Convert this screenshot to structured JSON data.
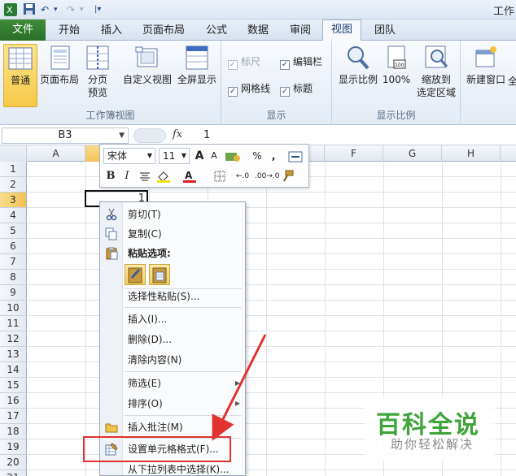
{
  "window": {
    "title": "工作"
  },
  "quick_access": {
    "undo": "↶",
    "redo": "↷",
    "more": "▾",
    "save": "💾"
  },
  "tabs": [
    {
      "label": "文件"
    },
    {
      "label": "开始"
    },
    {
      "label": "插入"
    },
    {
      "label": "页面布局"
    },
    {
      "label": "公式"
    },
    {
      "label": "数据"
    },
    {
      "label": "审阅"
    },
    {
      "label": "视图"
    },
    {
      "label": "团队"
    }
  ],
  "ribbon": {
    "workbook_views": {
      "label": "工作簿视图",
      "normal": "普通",
      "page_layout": "页面布局",
      "page_break_1": "分页",
      "page_break_2": "预览",
      "custom_view": "自定义视图",
      "full_screen": "全屏显示"
    },
    "show": {
      "label": "显示",
      "ruler": "标尺",
      "formula_bar": "编辑栏",
      "gridlines": "网格线",
      "headings": "标题"
    },
    "zoom": {
      "label": "显示比例",
      "zoom": "显示比例",
      "zoom100": "100%",
      "zoom_sel_1": "缩放到",
      "zoom_sel_2": "选定区域"
    },
    "window": {
      "new_window": "新建窗口",
      "more": "全"
    }
  },
  "formula_bar": {
    "name_box": "B3",
    "fx": "fx",
    "value": "1"
  },
  "columns": [
    "A",
    "B",
    "C",
    "D",
    "E",
    "F",
    "G",
    "H"
  ],
  "rows": [
    "1",
    "2",
    "3",
    "4",
    "5",
    "6",
    "7",
    "8",
    "9",
    "10",
    "11",
    "12",
    "13",
    "14",
    "15",
    "16",
    "17",
    "18",
    "19",
    "20",
    "21"
  ],
  "cell_b3": "1",
  "mini_toolbar": {
    "font": "宋体",
    "size": "11",
    "grow": "A",
    "shrink": "A",
    "percent": "%",
    "comma": ",",
    "bold": "B",
    "italic": "I",
    "inc_dec_1": "←.0",
    "inc_dec_2": ".00→.0"
  },
  "context_menu": {
    "cut": "剪切(T)",
    "copy": "复制(C)",
    "paste_options": "粘贴选项:",
    "paste_special": "选择性粘贴(S)...",
    "insert": "插入(I)...",
    "delete": "删除(D)...",
    "clear": "清除内容(N)",
    "filter": "筛选(E)",
    "sort": "排序(O)",
    "insert_comment": "插入批注(M)",
    "format_cells": "设置单元格格式(F)...",
    "pick_from_list": "从下拉列表中选择(K)..."
  },
  "watermark": {
    "title": "百科全说",
    "subtitle": "助你轻松解决"
  },
  "colors": {
    "accent": "#2a6e27",
    "highlight": "#e0332f",
    "selection": "#f1c256"
  }
}
